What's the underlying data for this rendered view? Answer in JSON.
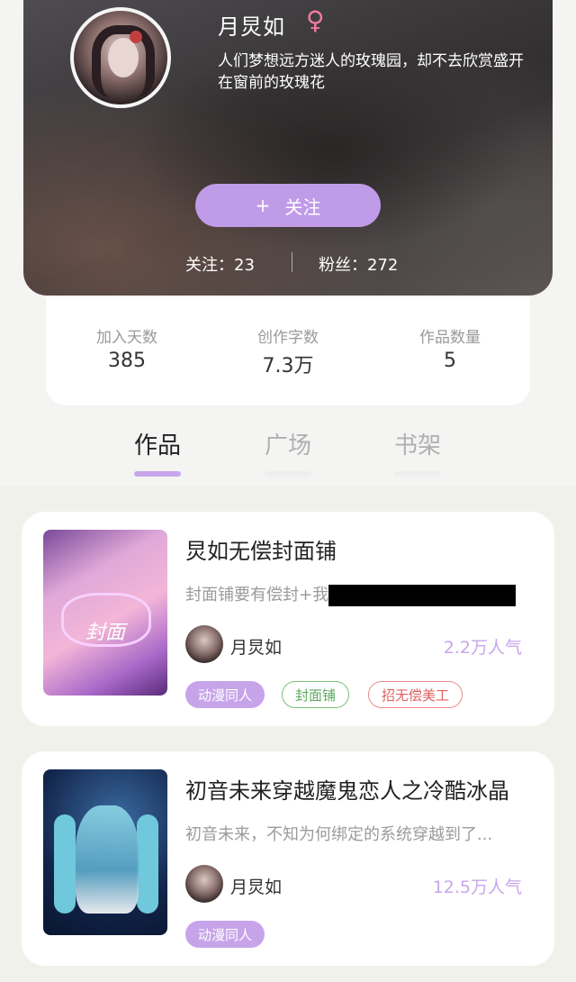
{
  "profile": {
    "name": "月炅如",
    "gender_icon": "♀",
    "bio": "人们梦想远方迷人的玫瑰园，却不去欣赏盛开在窗前的玫瑰花",
    "follow_button": {
      "plus": "+",
      "label": "关注"
    },
    "following": "关注：23",
    "fans": "粉丝：272"
  },
  "stats": [
    {
      "label": "加入天数",
      "value": "385"
    },
    {
      "label": "创作字数",
      "value": "7.3万"
    },
    {
      "label": "作品数量",
      "value": "5"
    }
  ],
  "tabs": [
    {
      "label": "作品",
      "active": true
    },
    {
      "label": "广场",
      "active": false
    },
    {
      "label": "书架",
      "active": false
    }
  ],
  "books": [
    {
      "title": "炅如无偿封面铺",
      "description": "封面铺要有偿封+我",
      "cover_text": "封面",
      "author": "月炅如",
      "popularity": "2.2万人气",
      "tags": [
        "动漫同人",
        "封面铺",
        "招无偿美工"
      ]
    },
    {
      "title": "初音未来穿越魔鬼恋人之冷酷冰晶",
      "description": "初音未来，不知为何绑定的系统穿越到了...",
      "author": "月炅如",
      "popularity": "12.5万人气",
      "tags": [
        "动漫同人"
      ]
    }
  ],
  "colors": {
    "accent": "#c09be8",
    "popularity": "#c9a6ec",
    "gender": "#f07aa0"
  }
}
